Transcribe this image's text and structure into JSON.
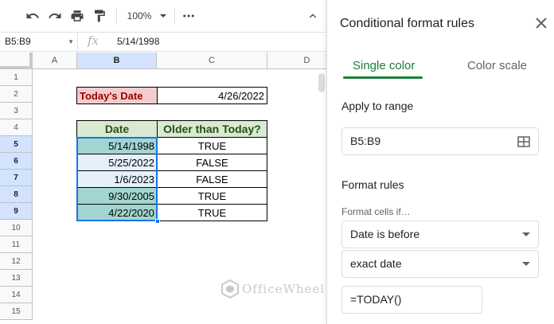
{
  "toolbar": {
    "zoom": "100%",
    "icons": [
      "undo-icon",
      "redo-icon",
      "print-icon",
      "paint-format-icon",
      "more-icon",
      "collapse-icon"
    ]
  },
  "formula_bar": {
    "name_box": "B5:B9",
    "fx_label": "fx",
    "formula": "5/14/1998"
  },
  "columns": [
    "A",
    "B",
    "C",
    "D"
  ],
  "rows": [
    "1",
    "2",
    "3",
    "4",
    "5",
    "6",
    "7",
    "8",
    "9",
    "10",
    "11",
    "12",
    "13",
    "14",
    "15"
  ],
  "cells": {
    "b2": "Today's Date",
    "c2": "4/26/2022",
    "b4": "Date",
    "c4": "Older than Today?",
    "data": [
      {
        "date": "5/14/1998",
        "older": "TRUE"
      },
      {
        "date": "5/25/2022",
        "older": "FALSE"
      },
      {
        "date": "1/6/2023",
        "older": "FALSE"
      },
      {
        "date": "9/30/2005",
        "older": "TRUE"
      },
      {
        "date": "4/22/2020",
        "older": "TRUE"
      }
    ]
  },
  "watermark": "OfficeWheel",
  "panel": {
    "title": "Conditional format rules",
    "tabs": [
      "Single color",
      "Color scale"
    ],
    "apply_to_range_label": "Apply to range",
    "range": "B5:B9",
    "format_rules_label": "Format rules",
    "format_cells_if_label": "Format cells if…",
    "condition": "Date is before",
    "date_option": "exact date",
    "value": "=TODAY()"
  },
  "colors": {
    "accent_green": "#188038",
    "selection_blue": "#1a73e8",
    "header_green": "#d9ead3",
    "label_red": "#f4cccc",
    "highlight_teal": "#a2d5d0"
  }
}
